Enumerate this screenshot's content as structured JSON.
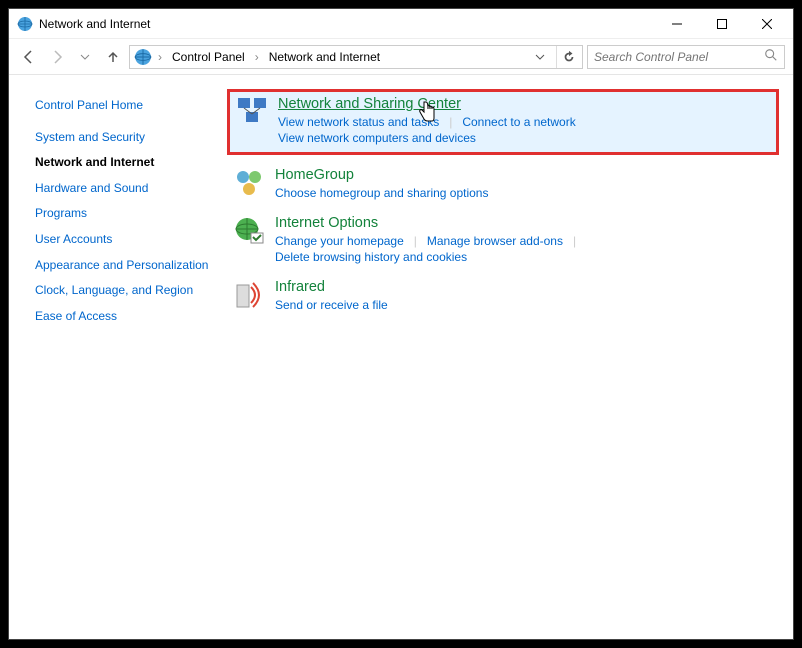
{
  "window": {
    "title": "Network and Internet"
  },
  "breadcrumb": {
    "root": "Control Panel",
    "current": "Network and Internet"
  },
  "search": {
    "placeholder": "Search Control Panel"
  },
  "sidebar": {
    "items": [
      {
        "label": "Control Panel Home",
        "active": false
      },
      {
        "label": "System and Security",
        "active": false
      },
      {
        "label": "Network and Internet",
        "active": true
      },
      {
        "label": "Hardware and Sound",
        "active": false
      },
      {
        "label": "Programs",
        "active": false
      },
      {
        "label": "User Accounts",
        "active": false
      },
      {
        "label": "Appearance and Personalization",
        "active": false
      },
      {
        "label": "Clock, Language, and Region",
        "active": false
      },
      {
        "label": "Ease of Access",
        "active": false
      }
    ]
  },
  "categories": [
    {
      "title": "Network and Sharing Center",
      "highlighted": true,
      "hovered": true,
      "sublinks": [
        "View network status and tasks",
        "Connect to a network",
        "View network computers and devices"
      ],
      "breakAfter": [
        1
      ]
    },
    {
      "title": "HomeGroup",
      "sublinks": [
        "Choose homegroup and sharing options"
      ]
    },
    {
      "title": "Internet Options",
      "sublinks": [
        "Change your homepage",
        "Manage browser add-ons",
        "Delete browsing history and cookies"
      ]
    },
    {
      "title": "Infrared",
      "sublinks": [
        "Send or receive a file"
      ]
    }
  ]
}
